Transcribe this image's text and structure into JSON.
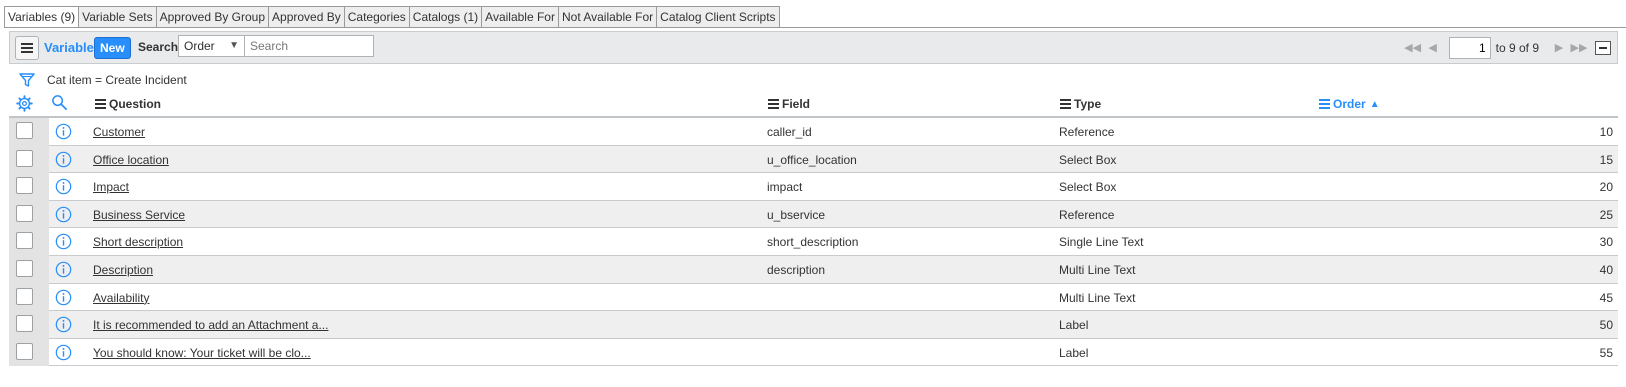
{
  "tabs": [
    {
      "label": "Variables (9)",
      "active": true
    },
    {
      "label": "Variable Sets"
    },
    {
      "label": "Approved By Group"
    },
    {
      "label": "Approved By"
    },
    {
      "label": "Categories"
    },
    {
      "label": "Catalogs (1)"
    },
    {
      "label": "Available For"
    },
    {
      "label": "Not Available For"
    },
    {
      "label": "Catalog Client Scripts"
    }
  ],
  "toolbar": {
    "list_title": "Variables",
    "new_label": "New",
    "search_label": "Search",
    "search_field": "Order",
    "search_placeholder": "Search"
  },
  "pager": {
    "current": "1",
    "range_text": "to 9 of 9"
  },
  "filter": {
    "breadcrumb": "Cat item = Create Incident"
  },
  "columns": {
    "question": "Question",
    "field": "Field",
    "type": "Type",
    "order": "Order"
  },
  "rows": [
    {
      "question": "Customer",
      "field": "caller_id",
      "type": "Reference",
      "order": "10"
    },
    {
      "question": "Office location",
      "field": "u_office_location",
      "type": "Select Box",
      "order": "15"
    },
    {
      "question": "Impact",
      "field": "impact",
      "type": "Select Box",
      "order": "20"
    },
    {
      "question": "Business Service",
      "field": "u_bservice",
      "type": "Reference",
      "order": "25"
    },
    {
      "question": "Short description",
      "field": "short_description",
      "type": "Single Line Text",
      "order": "30"
    },
    {
      "question": "Description",
      "field": "description",
      "type": "Multi Line Text",
      "order": "40"
    },
    {
      "question": "Availability",
      "field": "",
      "type": "Multi Line Text",
      "order": "45"
    },
    {
      "question": "It is recommended to add an Attachment a...",
      "field": "",
      "type": "Label",
      "order": "50"
    },
    {
      "question": "You should know: Your ticket will be clo...",
      "field": "",
      "type": "Label",
      "order": "55"
    }
  ],
  "colors": {
    "accent": "#278efc",
    "toolbar_bg": "#e8eaeb",
    "row_alt": "#efefef"
  },
  "icons": [
    "hamburger-icon",
    "first-page-icon",
    "prev-page-icon",
    "next-page-icon",
    "last-page-icon",
    "collapse-icon",
    "funnel-icon",
    "gear-icon",
    "search-icon",
    "info-icon"
  ]
}
